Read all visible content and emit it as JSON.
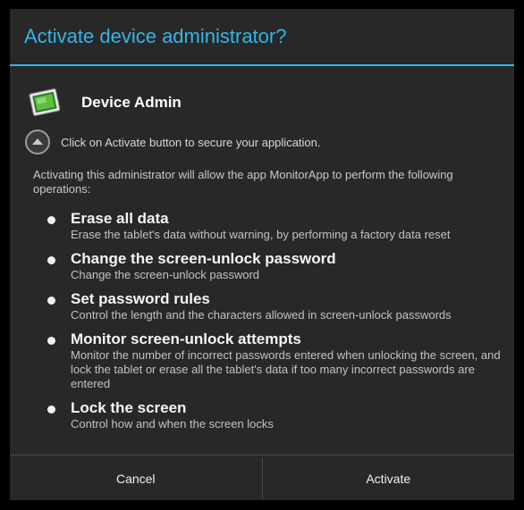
{
  "dialog": {
    "title": "Activate device administrator?"
  },
  "admin": {
    "icon": "monitor-app-icon",
    "name": "Device Admin"
  },
  "collapse": {
    "icon": "chevron-up-icon",
    "text": "Click on Activate button to secure your application."
  },
  "intro": "Activating this administrator will allow the app MonitorApp to perform the following operations:",
  "policies": [
    {
      "title": "Erase all data",
      "desc": "Erase the tablet's data without warning, by performing a factory data reset"
    },
    {
      "title": "Change the screen-unlock password",
      "desc": "Change the screen-unlock password"
    },
    {
      "title": "Set password rules",
      "desc": "Control the length and the characters allowed in screen-unlock passwords"
    },
    {
      "title": "Monitor screen-unlock attempts",
      "desc": "Monitor the number of incorrect passwords entered when unlocking the screen, and lock the tablet or erase all the tablet's data if too many incorrect passwords are entered"
    },
    {
      "title": "Lock the screen",
      "desc": "Control how and when the screen locks"
    }
  ],
  "buttons": {
    "cancel": "Cancel",
    "activate": "Activate"
  },
  "colors": {
    "accent": "#33b5e5",
    "dialog_background": "#282828",
    "screen_background": "#000000"
  }
}
